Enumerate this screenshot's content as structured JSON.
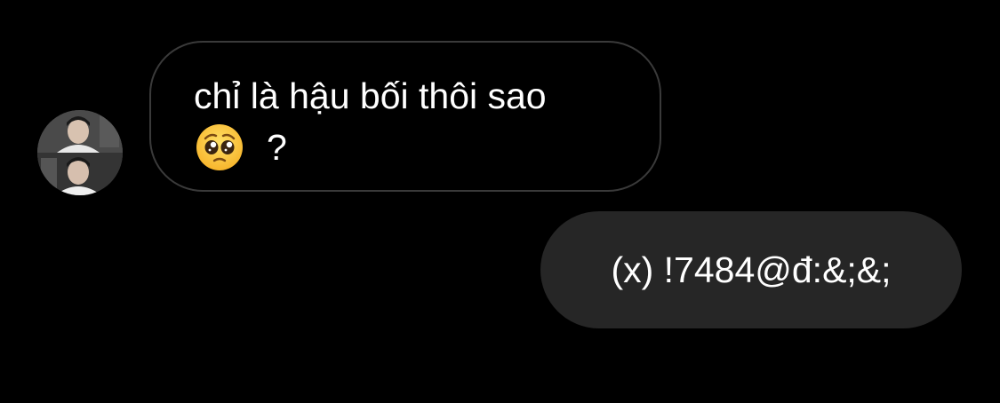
{
  "thread": {
    "incoming": {
      "line1": "chỉ là hậu bối thôi sao",
      "line2_text": "?",
      "emoji": "pleading-face-icon"
    },
    "outgoing": {
      "text": "(x) !7484@đ:&;&;"
    }
  },
  "colors": {
    "background": "#000000",
    "incoming_border": "#3a3a3a",
    "outgoing_bubble": "#262626",
    "text": "#ffffff"
  }
}
